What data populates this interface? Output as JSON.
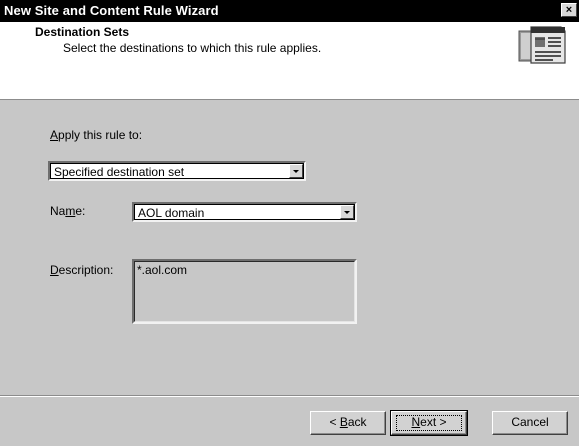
{
  "window": {
    "title": "New Site and Content Rule Wizard",
    "close_glyph": "×"
  },
  "header": {
    "title": "Destination Sets",
    "subtitle": "Select the destinations to which this rule applies.",
    "icon": "web-page-icon"
  },
  "form": {
    "apply_label_prefix": "",
    "apply_label_mnemonic": "A",
    "apply_label_rest": "pply this rule to:",
    "apply_value": "Specified destination set",
    "name_label_prefix": "Na",
    "name_label_mnemonic": "m",
    "name_label_rest": "e:",
    "name_value": "AOL domain",
    "description_label_prefix": "",
    "description_label_mnemonic": "D",
    "description_label_rest": "escription:",
    "description_value": "*.aol.com"
  },
  "buttons": {
    "back_prefix": "< ",
    "back_mnemonic": "B",
    "back_rest": "ack",
    "next_prefix": "",
    "next_mnemonic": "N",
    "next_rest": "ext >",
    "cancel": "Cancel"
  }
}
